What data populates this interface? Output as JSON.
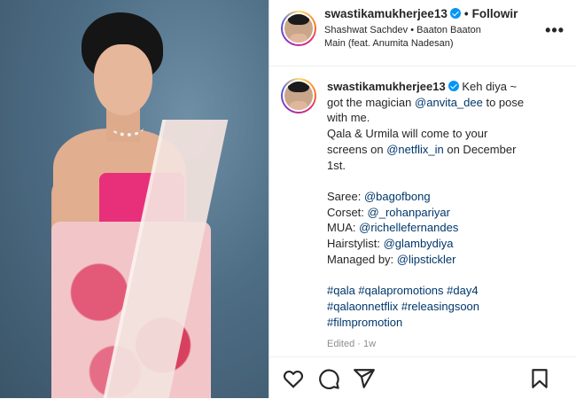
{
  "post": {
    "username": "swastikamukherjee13",
    "follow_label": "Followir",
    "audio_line1": "Shashwat Sachdev • Baaton Baaton",
    "audio_line2": "Main (feat. Anumita Nadesan)",
    "more_icon": "more-options-icon"
  },
  "caption": {
    "username": "swastikamukherjee13",
    "p1_text1": "Keh diya ~",
    "p1_text2": "got the magician",
    "p1_mention": "@anvita_dee",
    "p1_text3": "to pose",
    "p1_text4": "with me.",
    "p2_line1": "Qala & Urmila will come to your",
    "p2_text1": "screens on",
    "p2_mention": "@netflix_in",
    "p2_text2": "on December",
    "p2_line3": "1st.",
    "credits": [
      {
        "label": "Saree:",
        "handle": "@bagofbong"
      },
      {
        "label": "Corset:",
        "handle": "@_rohanpariyar"
      },
      {
        "label": "MUA:",
        "handle": "@richellefernandes"
      },
      {
        "label": "Hairstylist:",
        "handle": "@glambydiya"
      },
      {
        "label": "Managed by:",
        "handle": "@lipstickler"
      }
    ],
    "hashtags_line1": "#qala #qalapromotions #day4",
    "hashtags_line2": "#qalaonnetflix #releasingsoon",
    "hashtags_line3": "#filmpromotion",
    "edited": "Edited · 1w"
  },
  "actions": {
    "icons": [
      "heart-icon",
      "comment-icon",
      "share-icon",
      "bookmark-icon"
    ]
  },
  "colors": {
    "link": "#00376b",
    "verified": "#0095f6",
    "muted": "#8e8e8e"
  }
}
